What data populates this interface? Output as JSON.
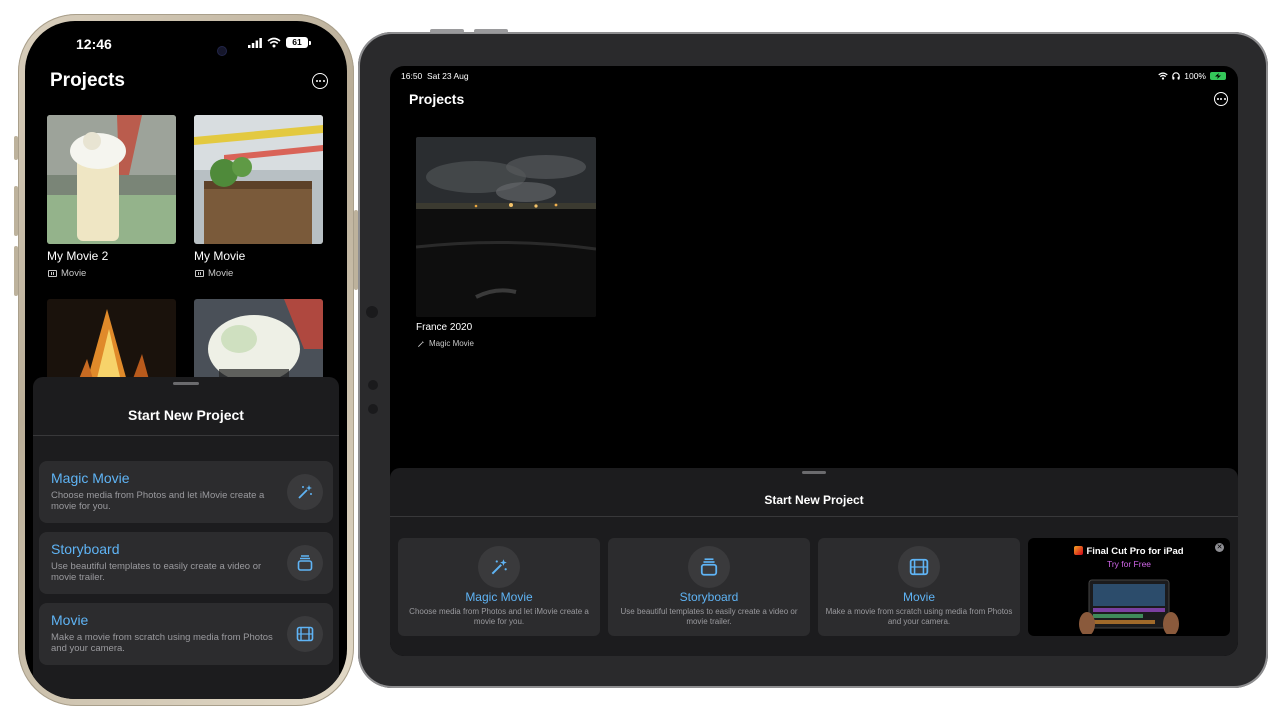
{
  "iphone": {
    "status": {
      "time": "12:46",
      "battery": "61"
    },
    "title": "Projects",
    "projects": [
      {
        "title": "My Movie 2",
        "type": "Movie"
      },
      {
        "title": "My Movie",
        "type": "Movie"
      }
    ],
    "sheet": {
      "title": "Start New Project",
      "options": [
        {
          "label": "Magic Movie",
          "description": "Choose media from Photos and let iMovie create a movie for you.",
          "icon": "magic-wand-icon"
        },
        {
          "label": "Storyboard",
          "description": "Use beautiful templates to easily create a video or movie trailer.",
          "icon": "storyboard-icon"
        },
        {
          "label": "Movie",
          "description": "Make a movie from scratch using media from Photos and your camera.",
          "icon": "film-icon"
        }
      ]
    }
  },
  "ipad": {
    "status": {
      "time": "16:50",
      "date": "Sat 23 Aug",
      "battery": "100%"
    },
    "title": "Projects",
    "projects": [
      {
        "title": "France 2020",
        "type": "Magic Movie"
      }
    ],
    "sheet": {
      "title": "Start New Project",
      "options": [
        {
          "label": "Magic Movie",
          "description": "Choose media from Photos and let iMovie create a movie for you.",
          "icon": "magic-wand-icon"
        },
        {
          "label": "Storyboard",
          "description": "Use beautiful templates to easily create a video or movie trailer.",
          "icon": "storyboard-icon"
        },
        {
          "label": "Movie",
          "description": "Make a movie from scratch using media from Photos and your camera.",
          "icon": "film-icon"
        }
      ],
      "promo": {
        "title": "Final Cut Pro for iPad",
        "subtitle": "Try for Free"
      }
    }
  },
  "colors": {
    "accent": "#5fb4f5",
    "sheet_bg": "#1c1c1e",
    "card_bg": "#2c2c2e",
    "promo_subtitle": "#d066e8"
  }
}
